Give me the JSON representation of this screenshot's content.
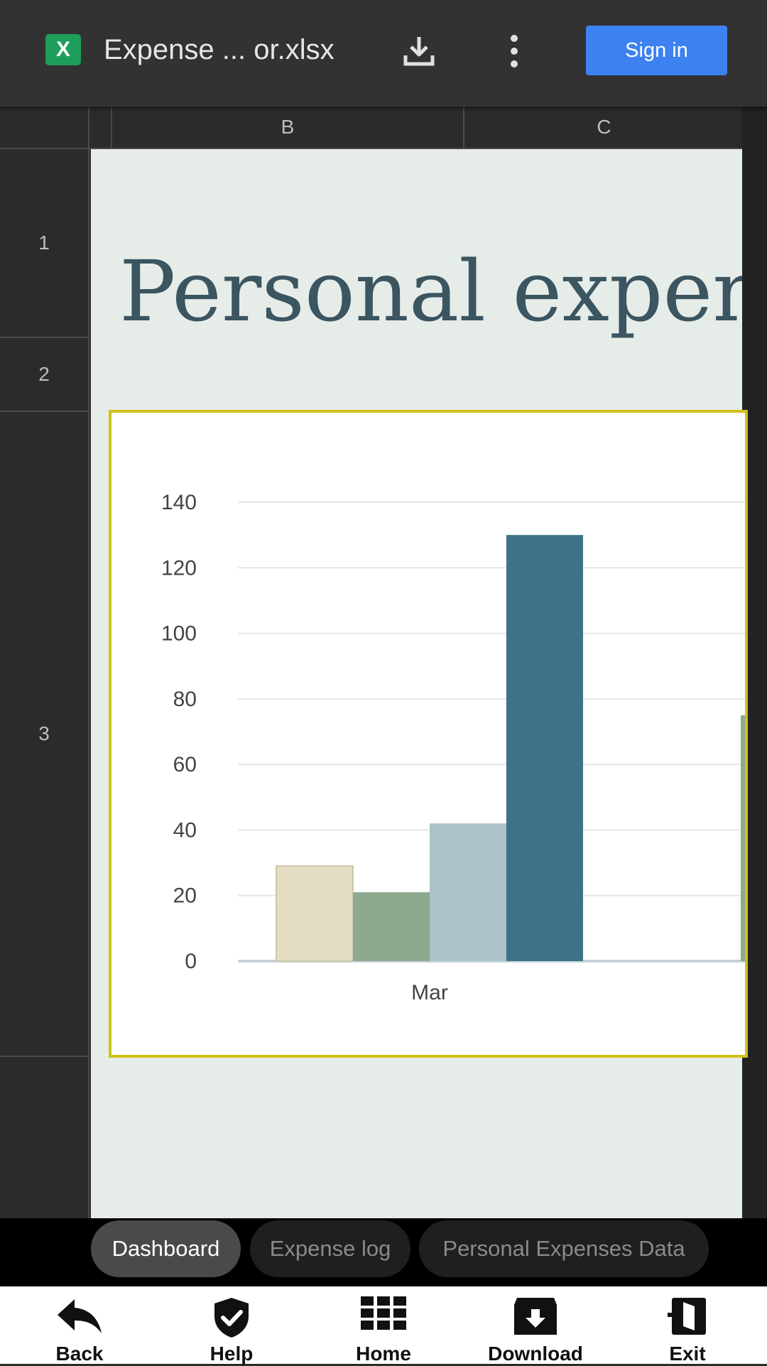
{
  "app_bar": {
    "file_icon_letter": "X",
    "file_icon_color": "#1e9e5b",
    "file_title": "Expense ... or.xlsx",
    "download_icon": "download-icon",
    "more_icon": "more-vert-icon",
    "signin_label": "Sign in",
    "signin_color": "#3d82f0"
  },
  "sheet": {
    "columns": [
      "B",
      "C"
    ],
    "rows": [
      "1",
      "2",
      "3"
    ],
    "title": "Personal expen",
    "title_color": "#3b5561",
    "background": "#e6ece8"
  },
  "chart_data": {
    "type": "bar",
    "categories": [
      "Mar"
    ],
    "series": [
      {
        "color": "#e3ddc4",
        "values": [
          29
        ]
      },
      {
        "color": "#8fa98f",
        "values": [
          21
        ]
      },
      {
        "color": "#abc2c8",
        "values": [
          42
        ]
      },
      {
        "color": "#3d7389",
        "values": [
          130
        ]
      }
    ],
    "partial_next_bar": {
      "color": "#8fa98f",
      "value": 75
    },
    "ylim": [
      0,
      140
    ],
    "yticks": [
      "0",
      "20",
      "40",
      "60",
      "80",
      "100",
      "120",
      "140"
    ],
    "grid": true,
    "border_color": "#cfc21a"
  },
  "tabs": [
    {
      "label": "Dashboard",
      "active": true
    },
    {
      "label": "Expense log",
      "active": false
    },
    {
      "label": "Personal Expenses Data",
      "active": false
    }
  ],
  "bottom_nav": [
    {
      "label": "Back",
      "icon": "reply-arrow-icon"
    },
    {
      "label": "Help",
      "icon": "shield-check-icon"
    },
    {
      "label": "Home",
      "icon": "grid-icon"
    },
    {
      "label": "Download",
      "icon": "download-box-icon"
    },
    {
      "label": "Exit",
      "icon": "exit-icon"
    }
  ]
}
